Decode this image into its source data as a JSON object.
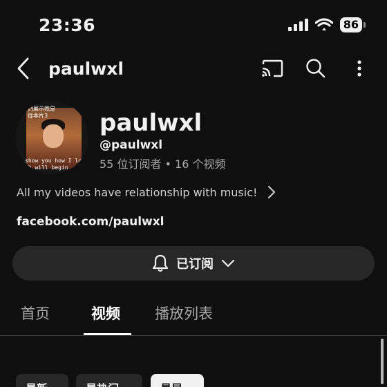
{
  "status_bar": {
    "time": "23:36",
    "battery": "86"
  },
  "top_bar": {
    "title": "paulwxl"
  },
  "channel": {
    "name": "paulwxl",
    "handle": "@paulwxl",
    "stats": "55 位订阅者 • 16 个视频",
    "description": "All my videos have relationship with music!",
    "link": "facebook.com/paulwxl",
    "avatar_captions": [
      "們展示我是",
      "從本片3",
      "show you how I lov",
      "ch will begin"
    ]
  },
  "subscribe": {
    "label": "已订阅"
  },
  "tabs": [
    {
      "label": "首页"
    },
    {
      "label": "视频"
    },
    {
      "label": "播放列表"
    }
  ],
  "filters": [
    {
      "label": "最新"
    },
    {
      "label": "最热门"
    },
    {
      "label": "最早"
    }
  ],
  "selected_tab": "视频",
  "selected_filter": "最早",
  "colors": {
    "background": "#0f0f0f",
    "surface": "#272727",
    "text": "#f1f1f1",
    "muted": "#aaaaaa"
  },
  "icons": [
    "back-icon",
    "cast-icon",
    "search-icon",
    "more-icon",
    "bell-icon",
    "chevron-down-icon",
    "chevron-right-icon",
    "signal-icon",
    "wifi-icon"
  ]
}
